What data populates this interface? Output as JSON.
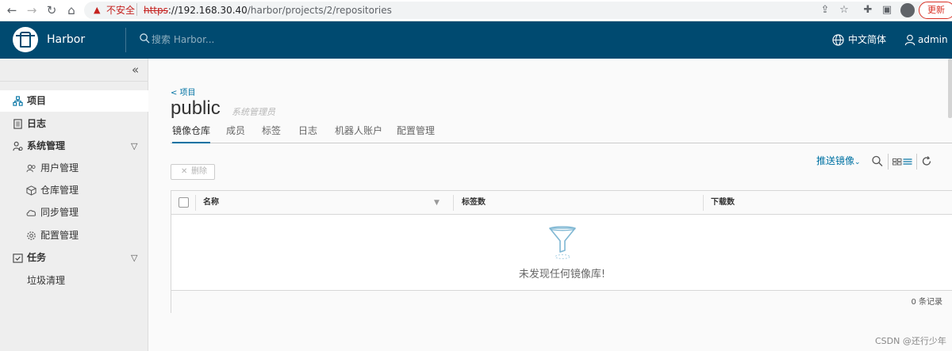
{
  "browser": {
    "security_warning": "不安全",
    "url_scheme": "https",
    "url_host": "://192.168.30.40",
    "url_path": "/harbor/projects/2/repositories",
    "update_label": "更新"
  },
  "header": {
    "brand": "Harbor",
    "search_placeholder": "搜索 Harbor...",
    "language": "中文简体",
    "user": "admin"
  },
  "sidebar": {
    "items": [
      {
        "label": "项目",
        "icon": "projects-icon"
      },
      {
        "label": "日志",
        "icon": "logs-icon"
      },
      {
        "label": "系统管理",
        "icon": "admin-icon"
      },
      {
        "label": "用户管理",
        "icon": "users-icon"
      },
      {
        "label": "仓库管理",
        "icon": "registries-icon"
      },
      {
        "label": "同步管理",
        "icon": "replication-icon"
      },
      {
        "label": "配置管理",
        "icon": "configuration-icon"
      },
      {
        "label": "任务",
        "icon": "tasks-icon"
      },
      {
        "label": "垃圾清理",
        "icon": ""
      }
    ]
  },
  "project": {
    "back_link": "< 项目",
    "name": "public",
    "role": "系统管理员"
  },
  "tabs": [
    {
      "label": "镜像仓库",
      "active": true
    },
    {
      "label": "成员",
      "active": false
    },
    {
      "label": "标签",
      "active": false
    },
    {
      "label": "日志",
      "active": false
    },
    {
      "label": "机器人账户",
      "active": false
    },
    {
      "label": "配置管理",
      "active": false
    }
  ],
  "toolbar": {
    "push_image": "推送镜像",
    "delete": "删除"
  },
  "table": {
    "columns": [
      "名称",
      "标签数",
      "下载数"
    ],
    "empty_text": "未发现任何镜像库!",
    "footer_count": "0 条记录"
  },
  "watermark": "CSDN @还行少年",
  "colors": {
    "header_bg": "#004a70",
    "accent": "#0072a3",
    "sidebar_bg": "#eeeeee",
    "insecure_red": "#c5221f"
  }
}
